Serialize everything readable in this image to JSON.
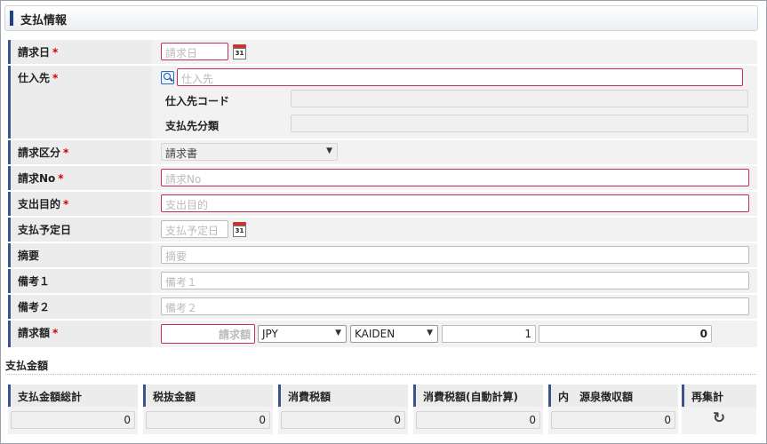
{
  "panel": {
    "title": "支払情報"
  },
  "form": {
    "billing_date": {
      "label": "請求日",
      "required": "*",
      "placeholder": "請求日"
    },
    "supplier": {
      "label": "仕入先",
      "required": "*",
      "placeholder": "仕入先",
      "code_label": "仕入先コード",
      "category_label": "支払先分類"
    },
    "billing_type": {
      "label": "請求区分",
      "required": "*",
      "selected": "請求書"
    },
    "billing_no": {
      "label": "請求No",
      "required": "*",
      "placeholder": "請求No"
    },
    "purpose": {
      "label": "支出目的",
      "required": "*",
      "placeholder": "支出目的"
    },
    "scheduled_date": {
      "label": "支払予定日",
      "placeholder": "支払予定日"
    },
    "summary": {
      "label": "摘要",
      "placeholder": "摘要"
    },
    "remark1": {
      "label": "備考１",
      "placeholder": "備考１"
    },
    "remark2": {
      "label": "備考２",
      "placeholder": "備考２"
    },
    "amount": {
      "label": "請求額",
      "required": "*",
      "placeholder": "請求額",
      "currency": "JPY",
      "rate_type": "KAIDEN",
      "rate": "1",
      "converted": "0"
    },
    "calendar_day": "31"
  },
  "payment_summary": {
    "title": "支払金額",
    "columns": [
      "支払金額総計",
      "税抜金額",
      "消費税額",
      "消費税額(自動計算)",
      "内　源泉徴収額",
      "再集計"
    ],
    "values": [
      "0",
      "0",
      "0",
      "0",
      "0"
    ]
  },
  "colors": {
    "accent": "#3b5391",
    "required_border": "#c92b5a",
    "required_mark": "#d40000"
  },
  "icons": {
    "calendar": "calendar-icon",
    "search": "search-icon",
    "refresh": "refresh-icon"
  }
}
